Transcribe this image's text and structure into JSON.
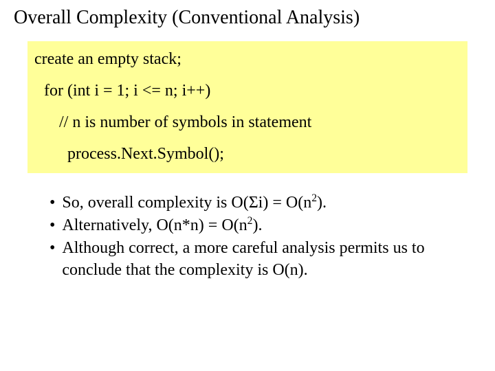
{
  "title": "Overall Complexity (Conventional Analysis)",
  "code": {
    "line1": "create an empty stack;",
    "line2": "for (int i = 1; i <= n; i++)",
    "line3": "// n is number of symbols in statement",
    "line4": "process.Next.Symbol();"
  },
  "bullets": {
    "b1_prefix": "So, overall complexity is O(",
    "b1_sigma": "Σ",
    "b1_mid": "i) = O(n",
    "b1_sup": "2",
    "b1_suffix": ").",
    "b2_prefix": "Alternatively, O(n*n) = O(n",
    "b2_sup": "2",
    "b2_suffix": ").",
    "b3": "Although correct, a more careful analysis permits us to conclude that the complexity is O(n)."
  },
  "marker": "•"
}
